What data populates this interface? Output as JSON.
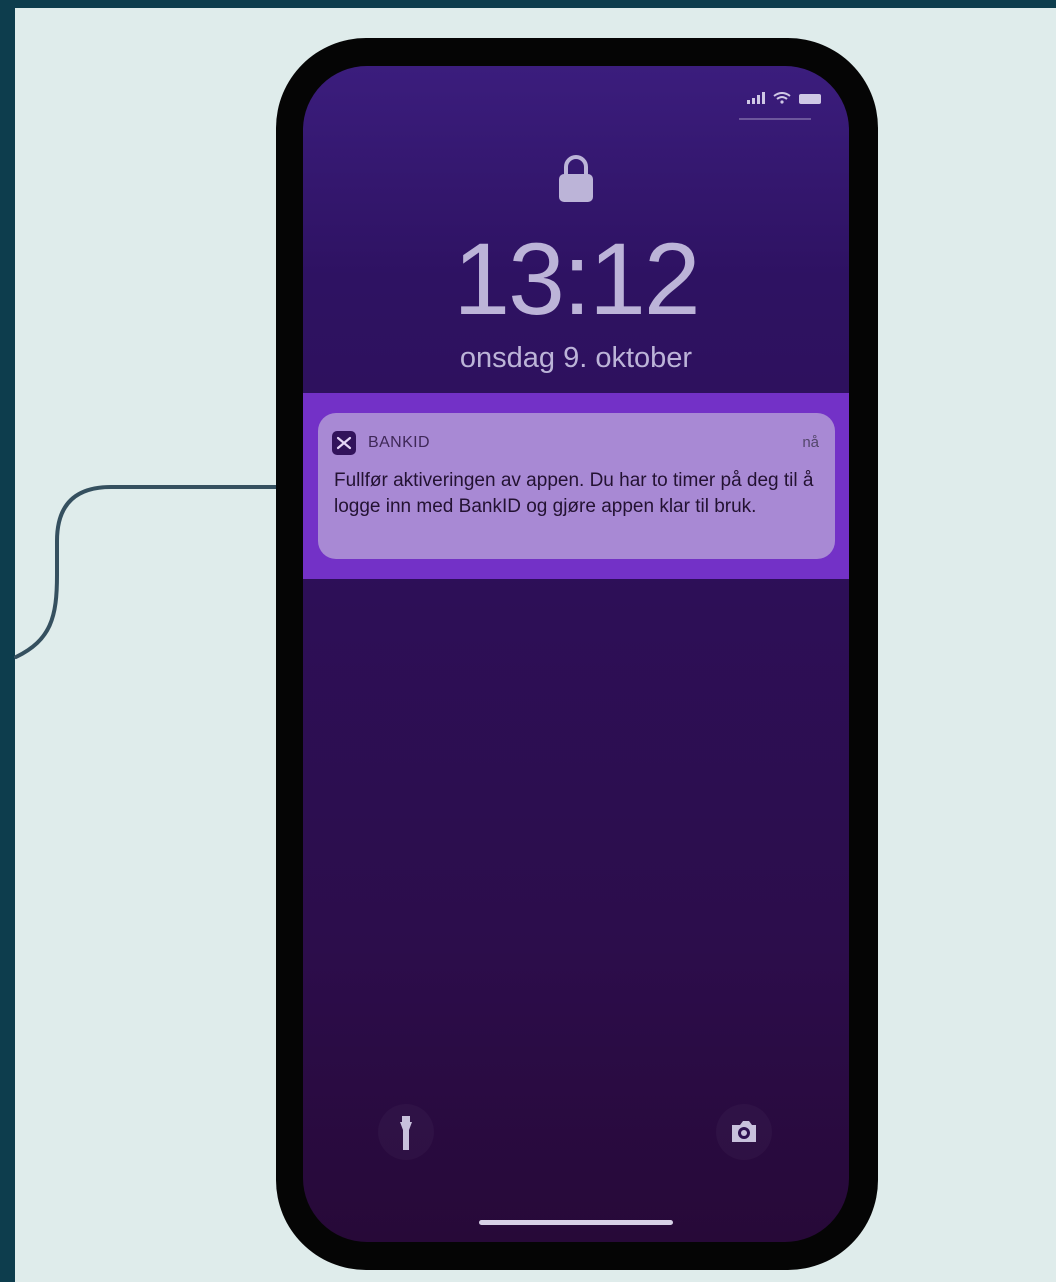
{
  "status_bar": {
    "icons": [
      "signal-icon",
      "wifi-icon",
      "battery-icon"
    ]
  },
  "lock_screen": {
    "time": "13:12",
    "date": "onsdag 9. oktober",
    "lock_icon": "lock-icon"
  },
  "notification": {
    "app_name": "BANKID",
    "time": "nå",
    "message": "Fullfør aktiveringen av appen. Du har to timer på deg til å logge inn med BankID og gjøre appen klar til bruk.",
    "app_icon": "bankid-icon"
  },
  "bottom_actions": {
    "left": "flashlight-icon",
    "right": "camera-icon"
  },
  "colors": {
    "background": "#0d3d4d",
    "panel": "#dfeceb",
    "phone_screen_top": "#3b1d7d",
    "phone_screen_bottom": "#270938",
    "notification_band": "#7331c7",
    "notification_card": "#a889d4",
    "connector_line": "#35505f"
  }
}
